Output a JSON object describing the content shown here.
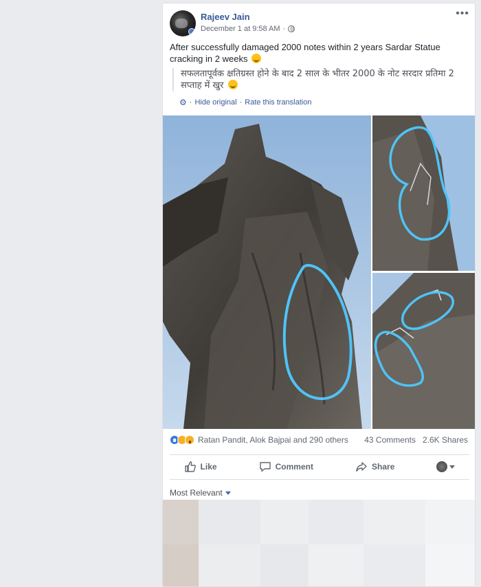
{
  "post": {
    "author": "Rajeev Jain",
    "timestamp": "December 1 at 9:58 AM",
    "privacy_icon": "globe-icon",
    "text": "After successfully damaged 2000 notes within 2 years Sardar Statue cracking in 2 weeks",
    "translation": "सफलतापूर्वक क्षतिग्रस्त होने के बाद 2 साल के भीतर 2000 के नोट सरदार प्रतिमा 2 सप्ताह में खुर",
    "hide_original": "Hide original",
    "rate_translation": "Rate this translation",
    "separator": "·"
  },
  "photos": [
    {
      "name": "statue-full"
    },
    {
      "name": "statue-crack-top"
    },
    {
      "name": "statue-crack-bottom"
    }
  ],
  "reactions": {
    "names": "Ratan Pandit, Alok Bajpai and 290 others",
    "comments": "43 Comments",
    "shares": "2.6K Shares"
  },
  "actions": {
    "like": "Like",
    "comment": "Comment",
    "share": "Share"
  },
  "comments": {
    "sort_label": "Most Relevant"
  },
  "colors": {
    "link": "#385898",
    "annotation": "#4fc3f7",
    "sky": "#a9c5e3"
  }
}
